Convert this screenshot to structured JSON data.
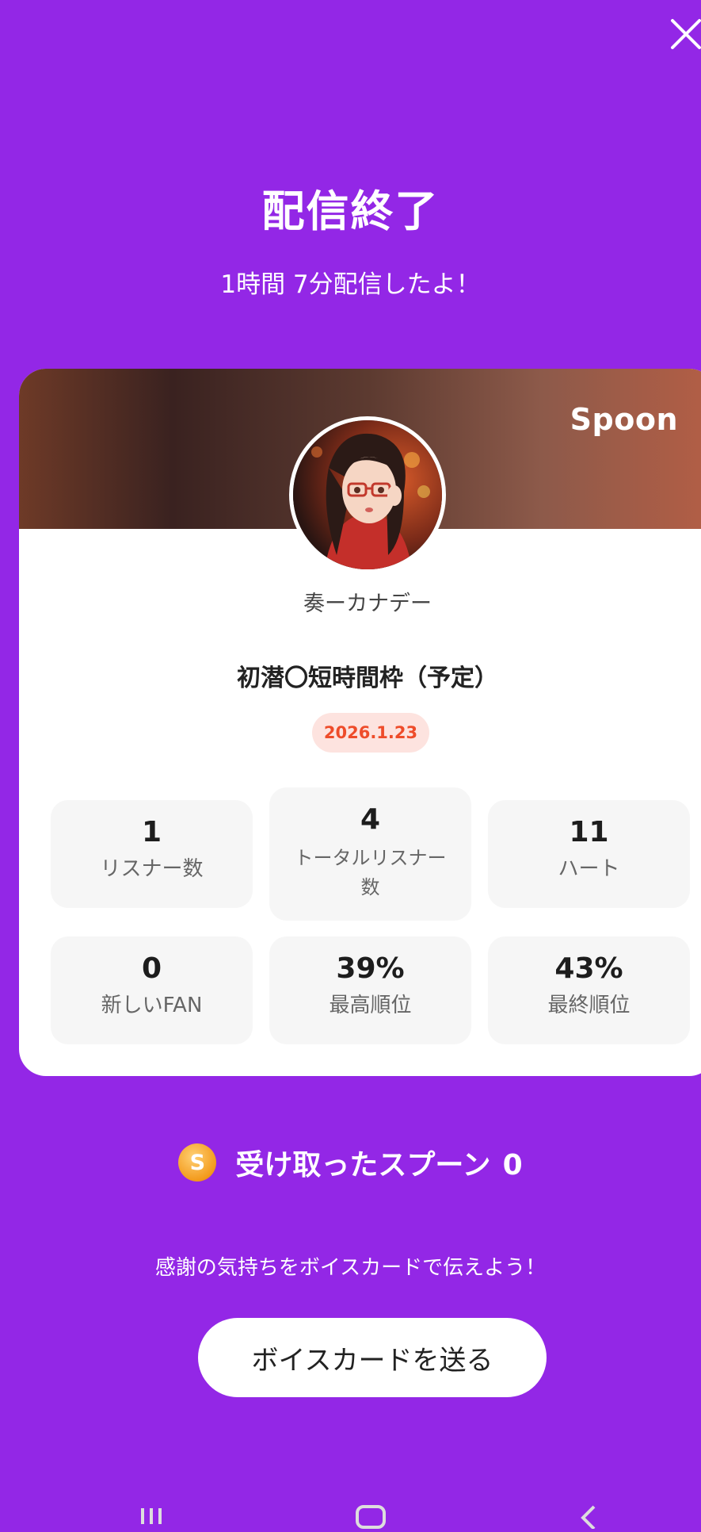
{
  "header": {
    "close_icon": "close-icon",
    "title": "配信終了",
    "subtitle": "1時間 7分配信したよ！"
  },
  "card": {
    "brand": "Spoon",
    "username": "奏ーカナデー",
    "stream_title": "初潜〇短時間枠（予定）",
    "date": "2026.1.23",
    "stats": [
      {
        "value": "1",
        "label": "リスナー数"
      },
      {
        "value": "4",
        "label_line1": "トータルリスナー",
        "label_line2": "数"
      },
      {
        "value": "11",
        "label": "ハート"
      },
      {
        "value": "0",
        "label": "新しいFAN"
      },
      {
        "value": "39%",
        "label": "最高順位"
      },
      {
        "value": "43%",
        "label": "最終順位"
      }
    ]
  },
  "spoons": {
    "coin_letter": "S",
    "label": "受け取ったスプーン",
    "count": "0"
  },
  "thanks_text": "感謝の気持ちをボイスカードで伝えよう！",
  "voice_card_button": "ボイスカードを送る",
  "colors": {
    "background": "#9327E6",
    "date_text": "#EE4C2A",
    "date_bg": "#FDE3DF"
  },
  "navbar": {
    "icons": [
      "recent-apps-icon",
      "home-icon",
      "back-icon"
    ]
  }
}
